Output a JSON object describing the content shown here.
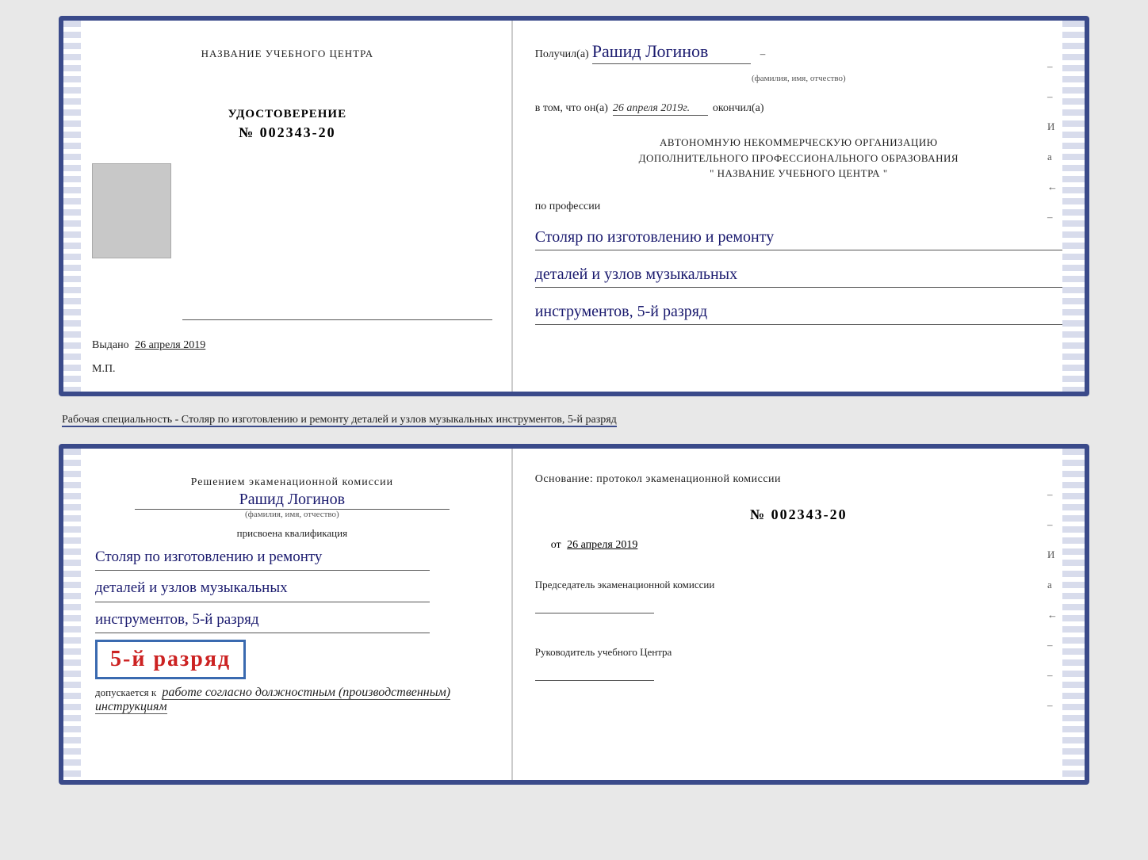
{
  "topDoc": {
    "left": {
      "centerTitle": "НАЗВАНИЕ УЧЕБНОГО ЦЕНТРА",
      "udostTitle": "УДОСТОВЕРЕНИЕ",
      "udostNumber": "№ 002343-20",
      "vydanoLabel": "Выдано",
      "vydanoDate": "26 апреля 2019",
      "mpLabel": "М.П."
    },
    "right": {
      "poluchilLabel": "Получил(а)",
      "recipientName": "Рашид Логинов",
      "nameSubLabel": "(фамилия, имя, отчество)",
      "vtomLabel": "в том, что он(а)",
      "completionDate": "26 апреля 2019г.",
      "okonchilLabel": "окончил(а)",
      "orgLine1": "АВТОНОМНУЮ НЕКОММЕРЧЕСКУЮ ОРГАНИЗАЦИЮ",
      "orgLine2": "ДОПОЛНИТЕЛЬНОГО ПРОФЕССИОНАЛЬНОГО ОБРАЗОВАНИЯ",
      "orgLine3": "\"  НАЗВАНИЕ УЧЕБНОГО ЦЕНТРА  \"",
      "poProfessiiLabel": "по профессии",
      "profLine1": "Столяр по изготовлению и ремонту",
      "profLine2": "деталей и узлов музыкальных",
      "profLine3": "инструментов, 5-й разряд"
    }
  },
  "specialtyInfo": "Рабочая специальность - Столяр по изготовлению и ремонту деталей и узлов музыкальных инструментов, 5-й разряд",
  "bottomDoc": {
    "left": {
      "resheniyemTitle": "Решением экаменационной комиссии",
      "recipientName": "Рашид Логинов",
      "nameSubLabel": "(фамилия, имя, отчество)",
      "prisvoenaLabel": "присвоена квалификация",
      "profLine1": "Столяр по изготовлению и ремонту",
      "profLine2": "деталей и узлов музыкальных",
      "profLine3": "инструментов, 5-й разряд",
      "razryadBig": "5-й разряд",
      "dopuskaetsyaLabel": "допускается к",
      "dopuskaetsyaText": "работе согласно должностным (производственным) инструкциям"
    },
    "right": {
      "osnovaniTitle": "Основание: протокол экаменационной комиссии",
      "protocolNumber": "№ 002343-20",
      "otLabel": "от",
      "otDate": "26 апреля 2019",
      "predsedatelLabel": "Председатель экаменационной комиссии",
      "rukovoditelLabel": "Руководитель учебного Центра"
    }
  }
}
